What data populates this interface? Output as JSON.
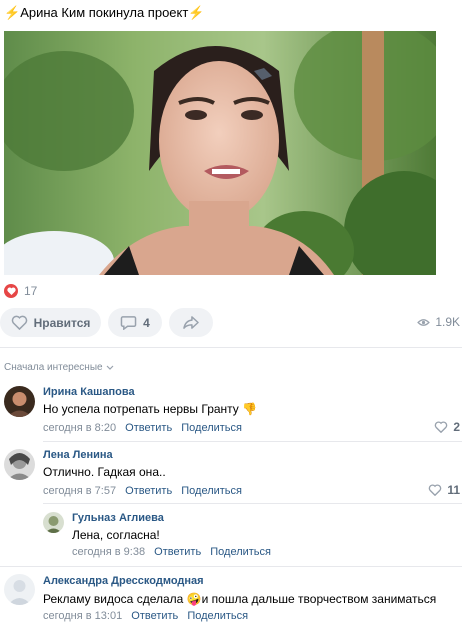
{
  "post": {
    "title_prefix": "⚡",
    "title": "Арина Ким покинула проект",
    "title_suffix": "⚡",
    "likes_count": "17",
    "like_label": "Нравится",
    "comments_count": "4",
    "views": "1.9K"
  },
  "comments_section": {
    "sort_label": "Сначала интересные",
    "reply_label": "Ответить",
    "share_label": "Поделиться"
  },
  "comments": [
    {
      "author": "Ирина Кашапова",
      "text": "Но успела потрепать нервы Гранту",
      "emoji": "👎",
      "time": "сегодня в 8:20",
      "likes": "2"
    },
    {
      "author": "Лена Ленина",
      "text": "Отлично. Гадкая она..",
      "time": "сегодня в 7:57",
      "likes": "11"
    },
    {
      "author": "Гульназ Аглиева",
      "text": "Лена, согласна!",
      "time": "сегодня в 9:38"
    },
    {
      "author": "Александра Дресскодмодная",
      "text_before": "Рекламу видоса сделала",
      "emoji": "🤪",
      "text_after": "и пошла дальше творчеством заниматься",
      "time": "сегодня в 13:01"
    }
  ],
  "icons": {
    "heart": "heart-icon",
    "comment": "comment-icon",
    "share": "share-icon",
    "views": "eye-icon",
    "sort_chevron": "chevron-down-icon"
  },
  "colors": {
    "link": "#2a5885",
    "like_red": "#e64646",
    "muted": "#818c99",
    "pill_bg": "#f0f2f5"
  }
}
